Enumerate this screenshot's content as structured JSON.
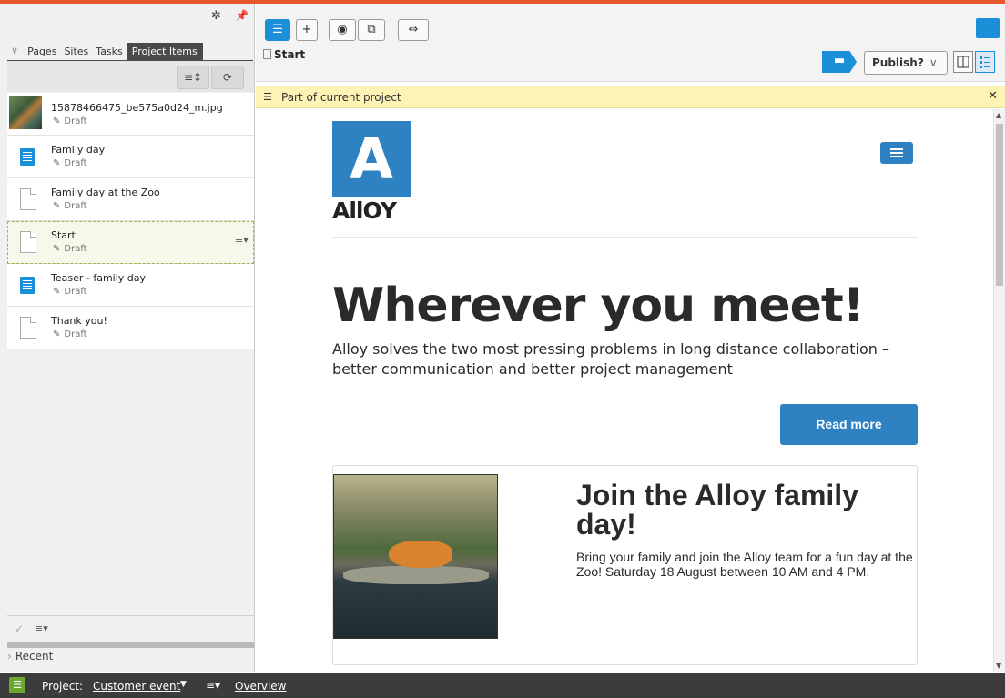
{
  "top_handle": "▾",
  "left": {
    "tabs": [
      "Pages",
      "Sites",
      "Tasks",
      "Project Items"
    ],
    "items": [
      {
        "title": "15878466475_be575a0d24_m.jpg",
        "status": "Draft",
        "icon": "image-thumbnail"
      },
      {
        "title": "Family day",
        "status": "Draft",
        "icon": "block-icon"
      },
      {
        "title": "Family day at the Zoo",
        "status": "Draft",
        "icon": "page-icon"
      },
      {
        "title": "Start",
        "status": "Draft",
        "icon": "page-icon",
        "selected": true
      },
      {
        "title": "Teaser - family day",
        "status": "Draft",
        "icon": "block-icon"
      },
      {
        "title": "Thank you!",
        "status": "Draft",
        "icon": "page-icon"
      }
    ],
    "recent": "Recent"
  },
  "header": {
    "breadcrumb": "Start",
    "publish_label": "Publish?"
  },
  "banner": {
    "text": "Part of current project"
  },
  "preview": {
    "logo_letter": "A",
    "logo_word": "AllOY",
    "hero_title": "Wherever you meet!",
    "hero_sub": "Alloy solves the two most pressing problems in long distance collaboration – better communication and better project management",
    "read_more": "Read more",
    "card_title": "Join the Alloy family day!",
    "card_text": "Bring your family and join the Alloy team for a fun day at the Zoo! Saturday 18 August between 10 AM and 4 PM."
  },
  "project_bar": {
    "label": "Project:",
    "name": "Customer event",
    "overview": "Overview"
  },
  "colors": {
    "accent": "#1b8fd8",
    "alloy_blue": "#2e82c2",
    "top_line": "#e8572a",
    "banner": "#fdf3b5",
    "project_green": "#6aa832"
  }
}
